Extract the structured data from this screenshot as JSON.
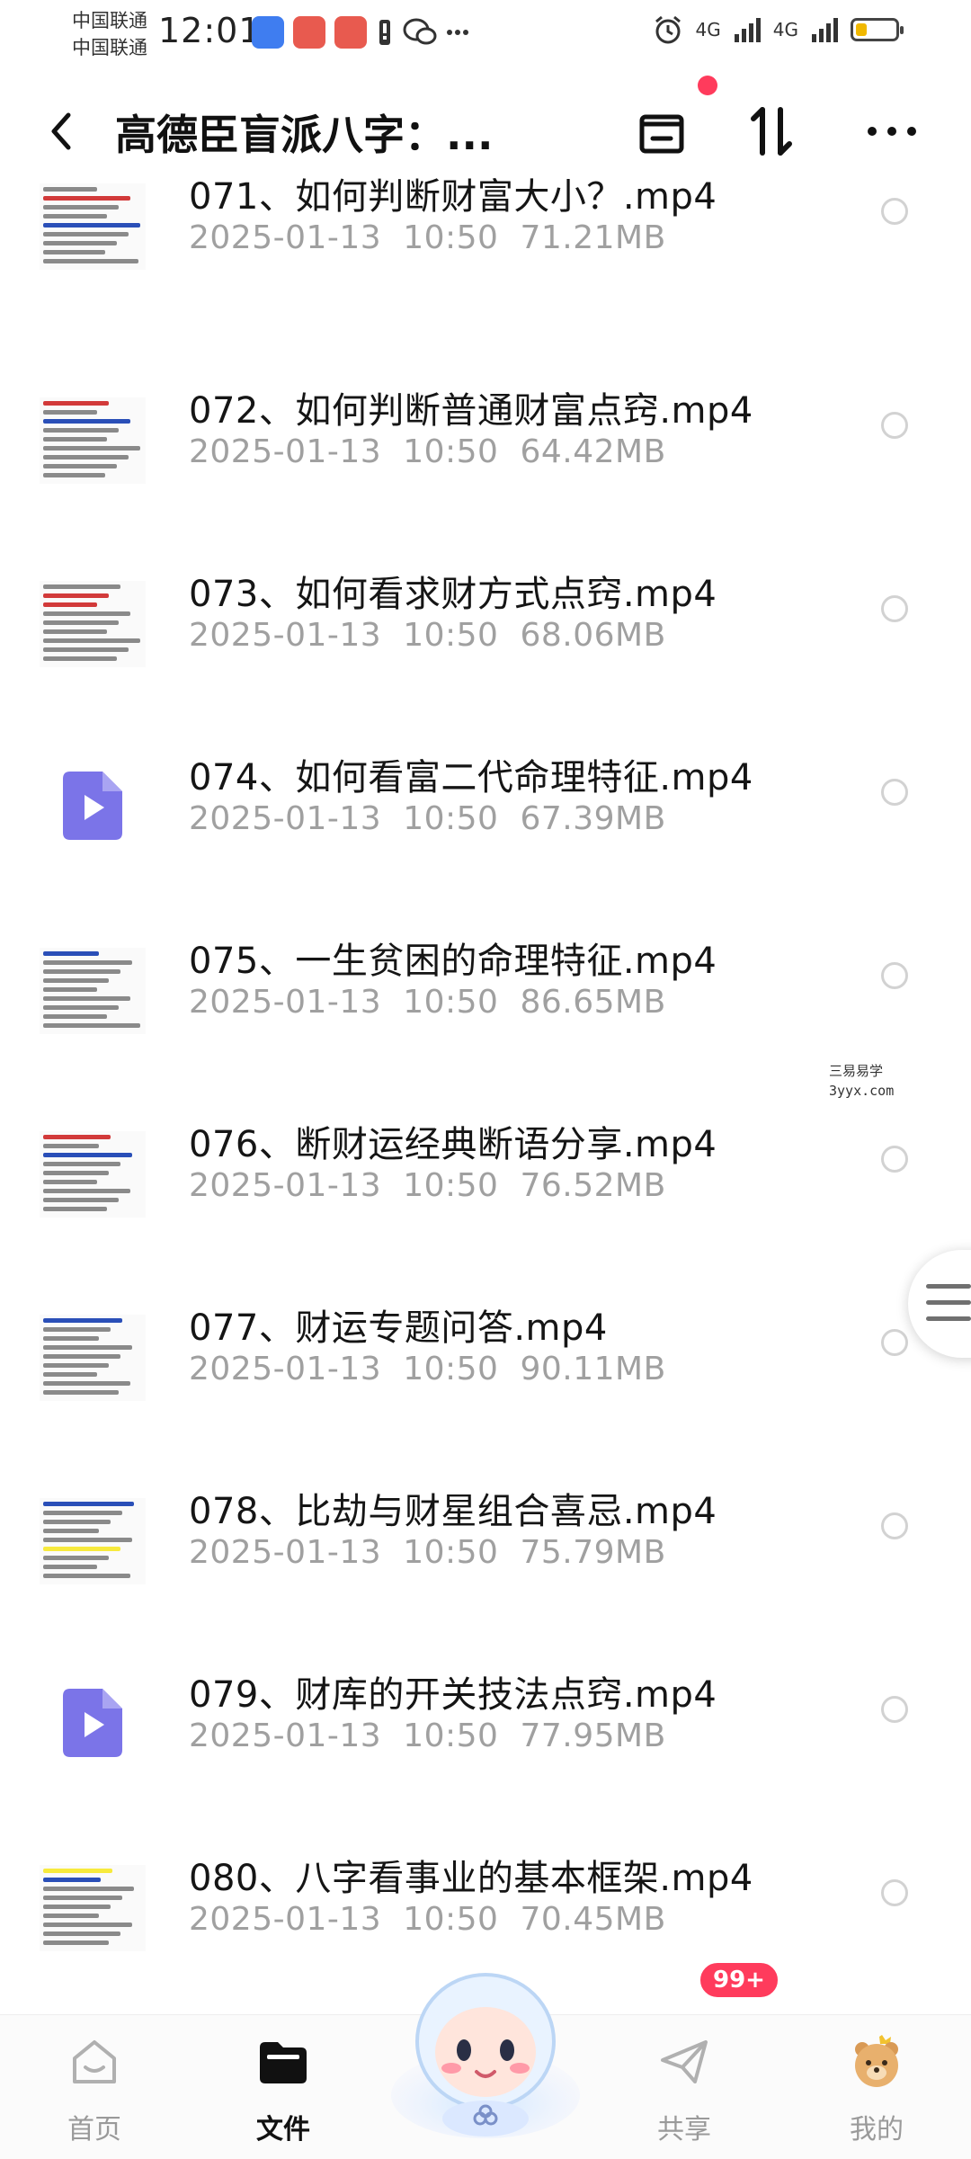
{
  "status_bar": {
    "carrier_line1": "中国联通",
    "carrier_line2": "中国联通",
    "time": "12:01",
    "signal1": "4G",
    "signal2": "4G"
  },
  "header": {
    "title": "高德臣盲派八字：..."
  },
  "files": [
    {
      "name": "071、如何判断财富大小？.mp4",
      "date": "2025-01-13",
      "time": "10:50",
      "size": "71.21MB",
      "thumb": "doc"
    },
    {
      "name": "072、如何判断普通财富点窍.mp4",
      "date": "2025-01-13",
      "time": "10:50",
      "size": "64.42MB",
      "thumb": "doc"
    },
    {
      "name": "073、如何看求财方式点窍.mp4",
      "date": "2025-01-13",
      "time": "10:50",
      "size": "68.06MB",
      "thumb": "doc"
    },
    {
      "name": "074、如何看富二代命理特征.mp4",
      "date": "2025-01-13",
      "time": "10:50",
      "size": "67.39MB",
      "thumb": "video"
    },
    {
      "name": "075、一生贫困的命理特征.mp4",
      "date": "2025-01-13",
      "time": "10:50",
      "size": "86.65MB",
      "thumb": "doc"
    },
    {
      "name": "076、断财运经典断语分享.mp4",
      "date": "2025-01-13",
      "time": "10:50",
      "size": "76.52MB",
      "thumb": "doc"
    },
    {
      "name": "077、财运专题问答.mp4",
      "date": "2025-01-13",
      "time": "10:50",
      "size": "90.11MB",
      "thumb": "doc"
    },
    {
      "name": "078、比劫与财星组合喜忌.mp4",
      "date": "2025-01-13",
      "time": "10:50",
      "size": "75.79MB",
      "thumb": "doc"
    },
    {
      "name": "079、财库的开关技法点窍.mp4",
      "date": "2025-01-13",
      "time": "10:50",
      "size": "77.95MB",
      "thumb": "video"
    },
    {
      "name": "080、八字看事业的基本框架.mp4",
      "date": "2025-01-13",
      "time": "10:50",
      "size": "70.45MB",
      "thumb": "doc"
    }
  ],
  "watermark": {
    "line1": "三易易学",
    "line2": "3yyx.com"
  },
  "bottom_nav": {
    "home": "首页",
    "files": "文件",
    "share": "共享",
    "mine": "我的",
    "share_badge": "99+"
  },
  "colors": {
    "video_icon": "#7b74e8",
    "badge": "#ff3b5c",
    "meta_text": "#a0a0a0"
  }
}
